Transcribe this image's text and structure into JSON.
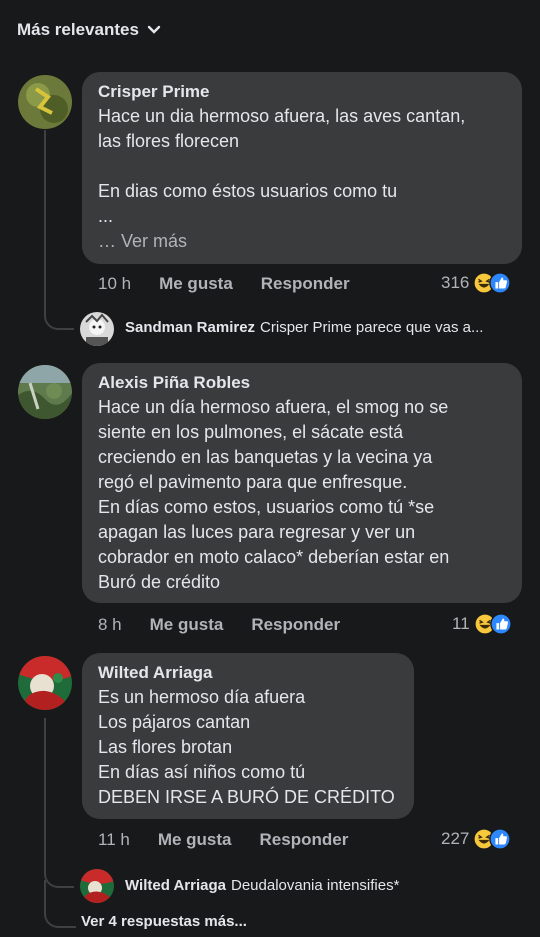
{
  "sort": {
    "label": "Más relevantes"
  },
  "comments": [
    {
      "author": "Crisper Prime",
      "text": "Hace un dia hermoso afuera, las aves cantan,\nlas flores florecen\n\nEn dias como éstos usuarios como tu\n...",
      "see_more": "… Ver más",
      "time": "10 h",
      "like": "Me gusta",
      "reply": "Responder",
      "reactions": "316"
    },
    {
      "author": "Alexis Piña Robles",
      "text": "Hace un día hermoso afuera, el smog no se\nsiente en los pulmones, el sácate está\ncreciendo en las banquetas y la vecina ya\nregó el pavimento para que enfresque.\n En días como estos, usuarios como tú *se\napagan las luces para regresar y ver un\ncobrador en moto calaco* deberían estar en\nBuró de crédito",
      "time": "8 h",
      "like": "Me gusta",
      "reply": "Responder",
      "reactions": "11"
    },
    {
      "author": "Wilted Arriaga",
      "text": "Es un hermoso día afuera\nLos pájaros cantan\nLas flores brotan\nEn días así niños como tú\nDEBEN IRSE A BURÓ DE CRÉDITO",
      "time": "11 h",
      "like": "Me gusta",
      "reply": "Responder",
      "reactions": "227"
    }
  ],
  "replies": [
    {
      "name": "Sandman Ramirez",
      "text": "Crisper Prime parece que vas a..."
    },
    {
      "name": "Wilted Arriaga",
      "text": "Deudalovania intensifies*"
    }
  ],
  "more_replies": "Ver 4 respuestas más...",
  "colors": {
    "bg": "#18191a",
    "bubble": "#3a3b3c",
    "secondary": "#b0b3b8",
    "like_blue": "#2d88ff"
  }
}
